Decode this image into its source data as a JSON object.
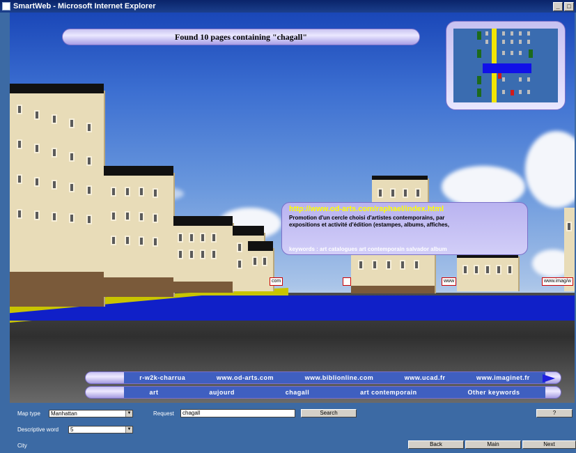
{
  "window": {
    "title": "SmartWeb - Microsoft Internet Explorer",
    "minimize": "_",
    "restore": "□"
  },
  "banner": {
    "text": "Found 10 pages containing \"chagall\""
  },
  "info_panel": {
    "url": "http://www.od-arts.com/raphael/index.html",
    "description": "Promotion d'un cercle choisi d'artistes contemporains, par\nexpositions et activité d'édition (estampes, albums, affiches,",
    "keywords": "keywords : art catalogues art contemporain salvador album"
  },
  "building_signs": [
    "com",
    "www",
    "www.imag/w"
  ],
  "sites_bar": {
    "items": [
      "r-w2k-charrua",
      "www.od-arts.com",
      "www.biblionline.com",
      "www.ucad.fr",
      "www.imaginet.fr"
    ]
  },
  "keywords_bar": {
    "items": [
      "art",
      "aujourd",
      "chagall",
      "art contemporain",
      "Other keywords"
    ]
  },
  "controls": {
    "map_type_label": "Map type",
    "map_type_value": "Manhattan",
    "descriptive_word_label": "Descriptive word",
    "descriptive_word_value": "5",
    "request_label": "Request",
    "request_value": "chagall",
    "search_label": "Search",
    "help_label": "?",
    "city_label": "City",
    "back_label": "Back",
    "main_label": "Main",
    "next_label": "Next"
  },
  "colors": {
    "accent_blue": "#1020c8",
    "url_yellow": "#ffff00",
    "panel_lavender": "#c7c1f1",
    "frame_blue": "#3c6aa4"
  }
}
